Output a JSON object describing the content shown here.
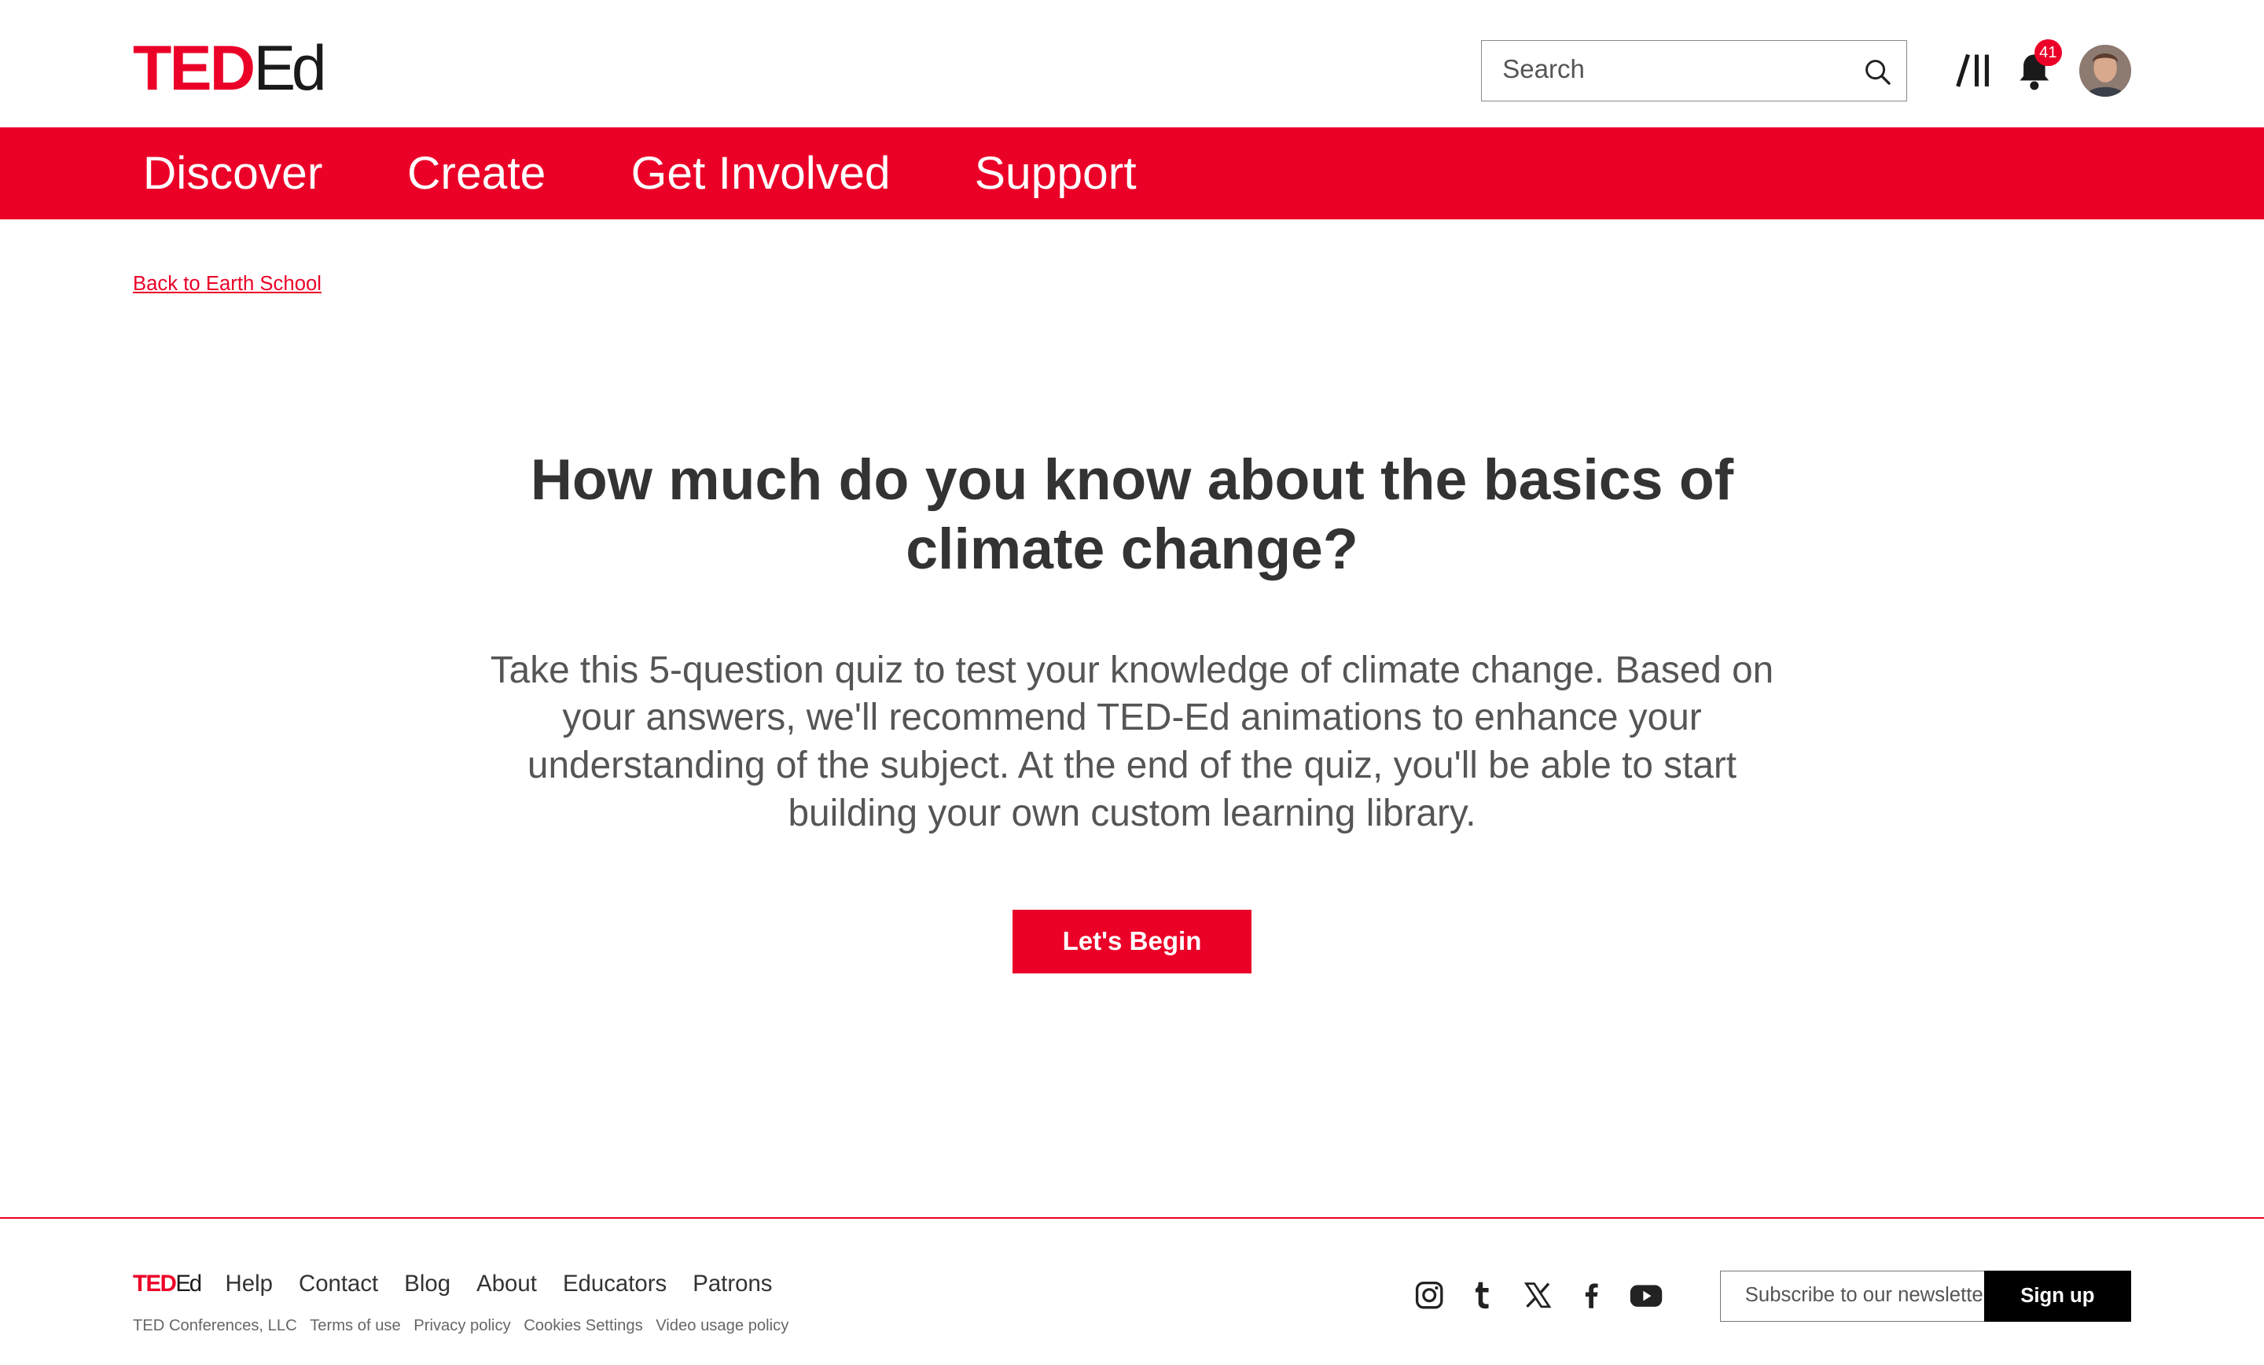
{
  "header": {
    "logo": {
      "ted": "TED",
      "ed": "Ed"
    },
    "search": {
      "placeholder": "Search"
    },
    "notifications": {
      "count": "41"
    }
  },
  "nav": {
    "items": [
      "Discover",
      "Create",
      "Get Involved",
      "Support"
    ]
  },
  "back_link": "Back to Earth School",
  "quiz": {
    "title": "How much do you know about the basics of climate change?",
    "description": "Take this 5-question quiz to test your knowledge of climate change. Based on your answers, we'll recommend TED-Ed animations to enhance your understanding of the subject. At the end of the quiz, you'll be able to start building your own custom learning library.",
    "begin_label": "Let's Begin"
  },
  "footer": {
    "logo": {
      "ted": "TED",
      "ed": "Ed"
    },
    "links": [
      "Help",
      "Contact",
      "Blog",
      "About",
      "Educators",
      "Patrons"
    ],
    "legal": [
      "TED Conferences, LLC",
      "Terms of use",
      "Privacy policy",
      "Cookies Settings",
      "Video usage policy"
    ],
    "social": [
      "instagram-icon",
      "tumblr-icon",
      "x-icon",
      "facebook-icon",
      "youtube-icon"
    ],
    "subscribe_placeholder": "Subscribe to our newsletter",
    "signup_label": "Sign up"
  },
  "colors": {
    "brand_red": "#eb0028",
    "text": "#333333",
    "signup_bg": "#000000"
  }
}
